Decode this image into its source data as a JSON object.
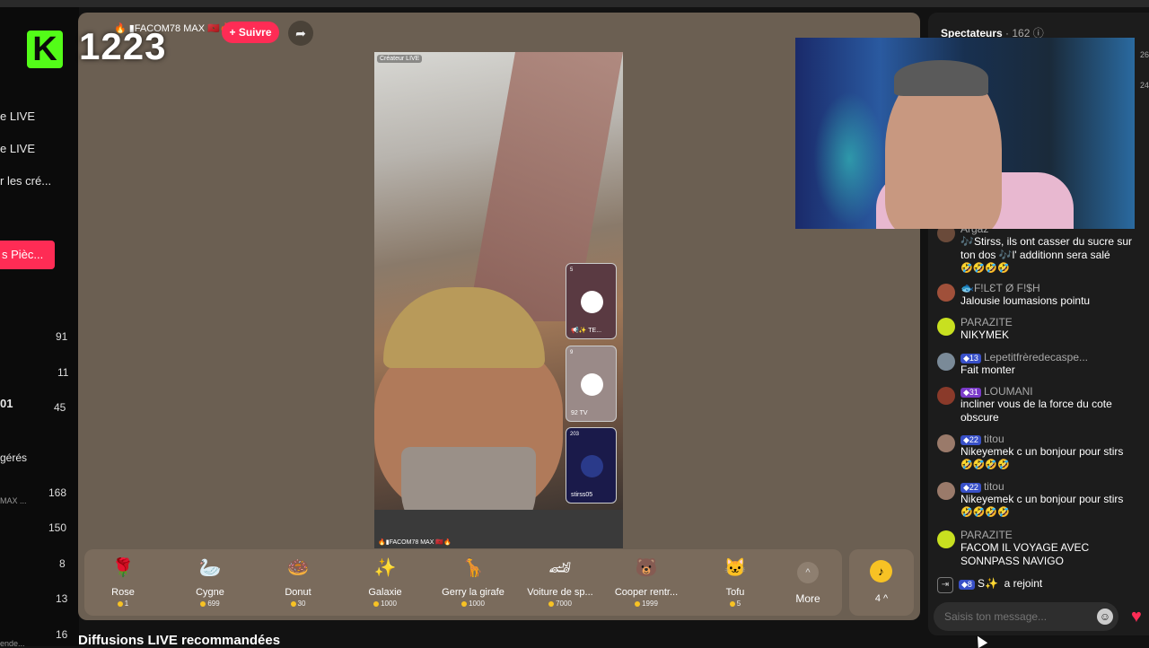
{
  "app": {
    "counter": "1223",
    "host_name": "🔥 ▮FACOM78 MAX 🇲🇦🔥",
    "follow_label": "+ Suivre",
    "recommended_title": "Diffusions LIVE recommandées"
  },
  "sidebar": {
    "logo": "K",
    "links": [
      "e LIVE",
      "e LIVE",
      "r les cré..."
    ],
    "button_label": "s Pièc...",
    "numbers": [
      "91",
      "11",
      "45",
      "168",
      "150",
      "8",
      "13",
      "16"
    ],
    "user_partial": "01",
    "section_partial": "gérés",
    "small_partial": "MAX ...",
    "small_partial_2": "ende..."
  },
  "video": {
    "tag": "Créateur LIVE",
    "caption": "🔥▮FACOM78 MAX 🇲🇦🔥",
    "guests": [
      {
        "count": "5",
        "label": "📢✨ TE..."
      },
      {
        "count": "9",
        "label": "92 TV"
      },
      {
        "count": "203",
        "label": "stirss05"
      }
    ]
  },
  "gifts": [
    {
      "name": "Rose",
      "price": "1",
      "icon": "🌹"
    },
    {
      "name": "Cygne",
      "price": "699",
      "icon": "🦢"
    },
    {
      "name": "Donut",
      "price": "30",
      "icon": "🍩"
    },
    {
      "name": "Galaxie",
      "price": "1000",
      "icon": "✨"
    },
    {
      "name": "Gerry la girafe",
      "price": "1000",
      "icon": "🦒"
    },
    {
      "name": "Voiture de sp...",
      "price": "7000",
      "icon": "🏎"
    },
    {
      "name": "Cooper rentr...",
      "price": "1999",
      "icon": "🐻"
    },
    {
      "name": "Tofu",
      "price": "5",
      "icon": "🐱"
    }
  ],
  "gift_bar": {
    "more_label": "More",
    "coin_count": "4 ^"
  },
  "chat": {
    "title": "Spectateurs",
    "viewer_count": "· 162",
    "edge_numbers": [
      "26",
      "24"
    ],
    "messages": [
      {
        "user": "Argaz",
        "badge": "",
        "text": "🎶Stirss, ils ont casser du sucre sur ton dos 🎶l' additionn sera salé",
        "emoji": "🤣🤣🤣🤣"
      },
      {
        "user": "🐟F!LƐT Ø F!$H",
        "badge": "",
        "text": "Jalousie loumasions pointu",
        "emoji": ""
      },
      {
        "user": "PARAZITE",
        "badge": "",
        "text": "NIKYMEK",
        "emoji": ""
      },
      {
        "user": "Lepetitfrèredecaspe...",
        "badge": "13",
        "text": "Fait monter",
        "emoji": ""
      },
      {
        "user": "LOUMANI",
        "badge": "31",
        "text": "incliner vous de la force du cote obscure",
        "emoji": ""
      },
      {
        "user": "titou",
        "badge": "22",
        "text": "Nikeyemek c un bonjour pour stirs",
        "emoji": "🤣🤣🤣🤣"
      },
      {
        "user": "titou",
        "badge": "22",
        "text": "Nikeyemek c un bonjour pour stirs",
        "emoji": "🤣🤣🤣🤣"
      },
      {
        "user": "PARAZITE",
        "badge": "",
        "text": "FACOM IL VOYAGE AVEC SONNPASS NAVIGO",
        "emoji": ""
      }
    ],
    "joined": {
      "badge": "8",
      "user": "S✨",
      "text": "a rejoint"
    },
    "input_placeholder": "Saisis ton message..."
  }
}
